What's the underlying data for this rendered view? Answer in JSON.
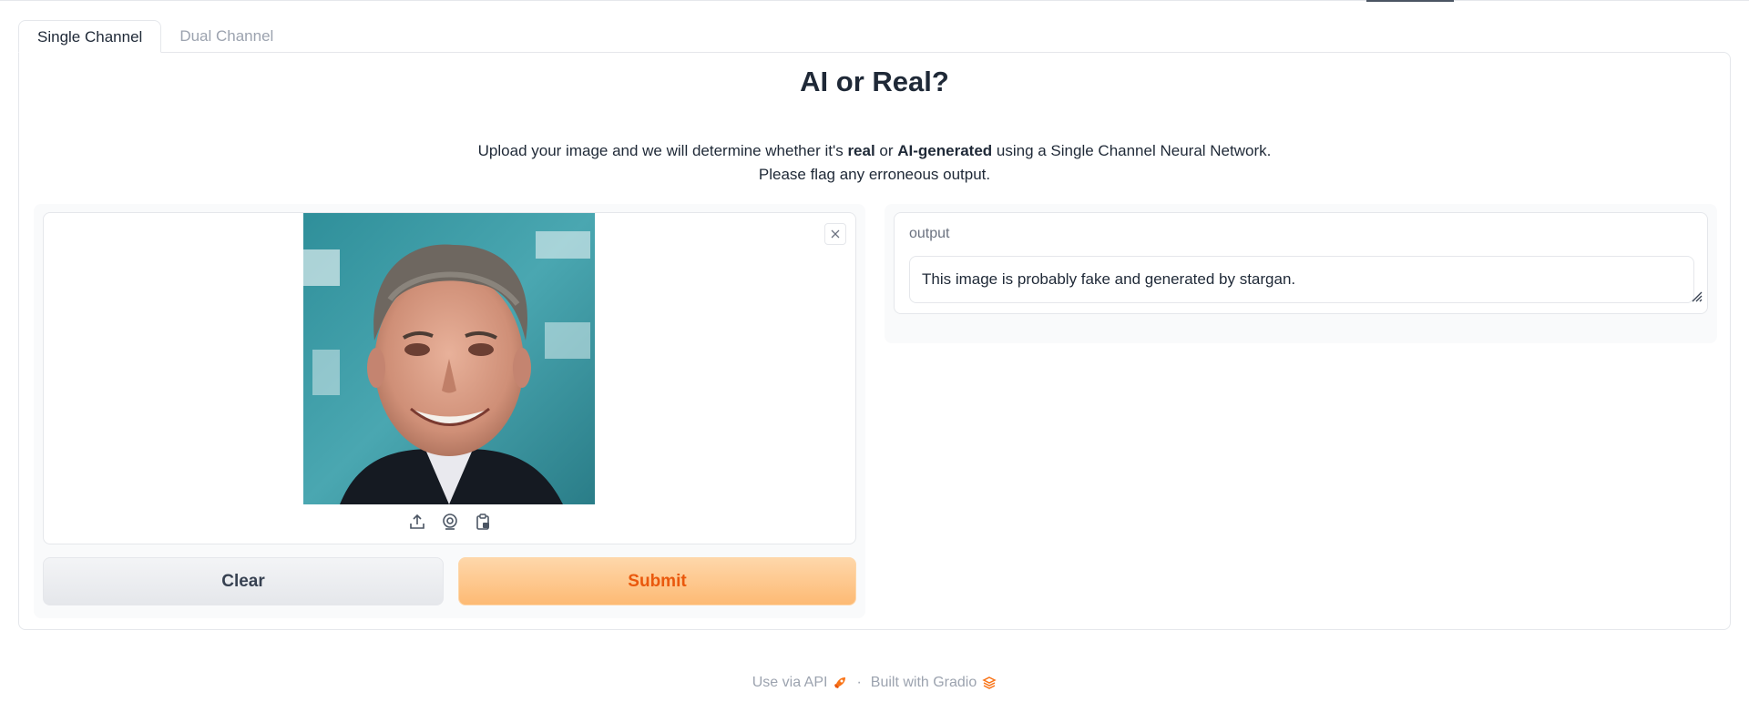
{
  "tabs": [
    {
      "label": "Single Channel",
      "active": true
    },
    {
      "label": "Dual Channel",
      "active": false
    }
  ],
  "page": {
    "title": "AI or Real?",
    "description": {
      "part1": "Upload your image and we will determine whether it's ",
      "bold1": "real",
      "part2": " or ",
      "bold2": "AI-generated",
      "part3": " using a Single Channel Neural Network.",
      "line2": "Please flag any erroneous output."
    }
  },
  "image_input": {
    "close_icon": "close-icon",
    "source_icons": [
      "upload-icon",
      "webcam-icon",
      "clipboard-icon"
    ]
  },
  "buttons": {
    "clear": "Clear",
    "submit": "Submit"
  },
  "output": {
    "label": "output",
    "value": "This image is probably fake and generated by stargan."
  },
  "footer": {
    "api": "Use via API",
    "separator": "·",
    "built": "Built with Gradio"
  },
  "colors": {
    "accent": "#ea580c",
    "submit_bg": "#fdba74",
    "border": "#e5e7eb"
  }
}
